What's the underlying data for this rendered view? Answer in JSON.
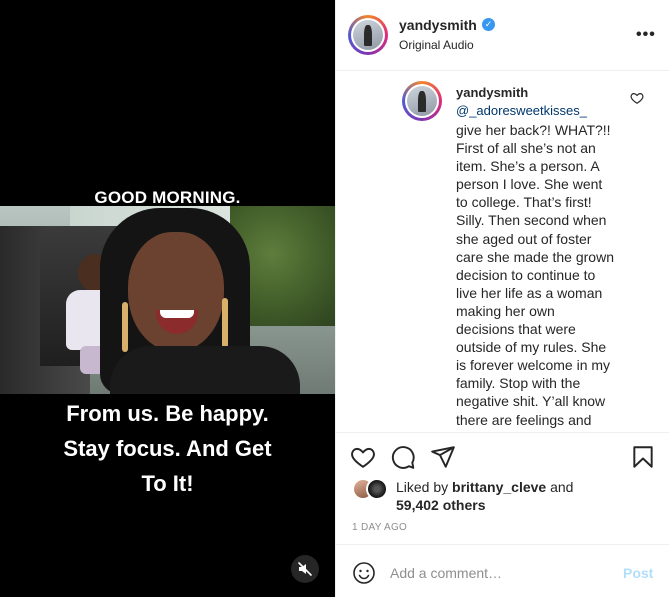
{
  "video": {
    "caption_top": "GOOD MORNING.",
    "caption_bottom_lines": [
      "From us. Be happy.",
      "Stay focus. And Get",
      "To It!"
    ],
    "mute_icon": "speaker-muted-icon"
  },
  "header": {
    "username": "yandysmith",
    "verified_icon": "verified-badge-icon",
    "audio_label": "Original Audio",
    "more_icon": "more-options-icon",
    "more_glyph": "•••"
  },
  "comment": {
    "username": "yandysmith",
    "mention": "@_adoresweetkisses_",
    "text": "give her back?! WHAT?!! First of all she’s not an item. She’s a person. A person I love. She went to college. That’s first! Silly. Then second when she aged out of foster care she made the grown decision to continue to live her life as a woman making her own decisions that were outside of my rules. She is forever welcome in my family. Stop with the negative shit. Y’all know there are feelings and",
    "like_icon": "heart-outline-icon"
  },
  "actions": {
    "like_icon": "heart-outline-icon",
    "comment_icon": "comment-bubble-icon",
    "share_icon": "paper-plane-icon",
    "save_icon": "bookmark-icon"
  },
  "likes": {
    "prefix": "Liked by ",
    "user": "brittany_cleve",
    "suffix": " and",
    "others": "59,402 others"
  },
  "timestamp": "1 DAY AGO",
  "add_comment": {
    "placeholder": "Add a comment…",
    "post_label": "Post",
    "emoji_icon": "smiley-face-icon"
  },
  "colors": {
    "link": "#00376b",
    "verified": "#3897f0",
    "post_disabled": "#b2dffc",
    "muted_text": "#8e8e8e"
  }
}
